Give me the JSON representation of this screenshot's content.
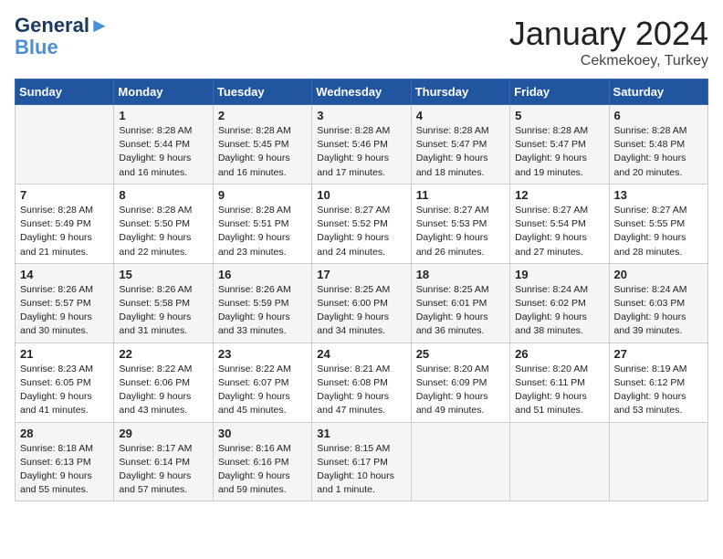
{
  "header": {
    "logo_line1": "General",
    "logo_line2": "Blue",
    "month": "January 2024",
    "location": "Cekmekoey, Turkey"
  },
  "weekdays": [
    "Sunday",
    "Monday",
    "Tuesday",
    "Wednesday",
    "Thursday",
    "Friday",
    "Saturday"
  ],
  "weeks": [
    [
      {
        "day": "",
        "info": ""
      },
      {
        "day": "1",
        "info": "Sunrise: 8:28 AM\nSunset: 5:44 PM\nDaylight: 9 hours\nand 16 minutes."
      },
      {
        "day": "2",
        "info": "Sunrise: 8:28 AM\nSunset: 5:45 PM\nDaylight: 9 hours\nand 16 minutes."
      },
      {
        "day": "3",
        "info": "Sunrise: 8:28 AM\nSunset: 5:46 PM\nDaylight: 9 hours\nand 17 minutes."
      },
      {
        "day": "4",
        "info": "Sunrise: 8:28 AM\nSunset: 5:47 PM\nDaylight: 9 hours\nand 18 minutes."
      },
      {
        "day": "5",
        "info": "Sunrise: 8:28 AM\nSunset: 5:47 PM\nDaylight: 9 hours\nand 19 minutes."
      },
      {
        "day": "6",
        "info": "Sunrise: 8:28 AM\nSunset: 5:48 PM\nDaylight: 9 hours\nand 20 minutes."
      }
    ],
    [
      {
        "day": "7",
        "info": "Sunrise: 8:28 AM\nSunset: 5:49 PM\nDaylight: 9 hours\nand 21 minutes."
      },
      {
        "day": "8",
        "info": "Sunrise: 8:28 AM\nSunset: 5:50 PM\nDaylight: 9 hours\nand 22 minutes."
      },
      {
        "day": "9",
        "info": "Sunrise: 8:28 AM\nSunset: 5:51 PM\nDaylight: 9 hours\nand 23 minutes."
      },
      {
        "day": "10",
        "info": "Sunrise: 8:27 AM\nSunset: 5:52 PM\nDaylight: 9 hours\nand 24 minutes."
      },
      {
        "day": "11",
        "info": "Sunrise: 8:27 AM\nSunset: 5:53 PM\nDaylight: 9 hours\nand 26 minutes."
      },
      {
        "day": "12",
        "info": "Sunrise: 8:27 AM\nSunset: 5:54 PM\nDaylight: 9 hours\nand 27 minutes."
      },
      {
        "day": "13",
        "info": "Sunrise: 8:27 AM\nSunset: 5:55 PM\nDaylight: 9 hours\nand 28 minutes."
      }
    ],
    [
      {
        "day": "14",
        "info": "Sunrise: 8:26 AM\nSunset: 5:57 PM\nDaylight: 9 hours\nand 30 minutes."
      },
      {
        "day": "15",
        "info": "Sunrise: 8:26 AM\nSunset: 5:58 PM\nDaylight: 9 hours\nand 31 minutes."
      },
      {
        "day": "16",
        "info": "Sunrise: 8:26 AM\nSunset: 5:59 PM\nDaylight: 9 hours\nand 33 minutes."
      },
      {
        "day": "17",
        "info": "Sunrise: 8:25 AM\nSunset: 6:00 PM\nDaylight: 9 hours\nand 34 minutes."
      },
      {
        "day": "18",
        "info": "Sunrise: 8:25 AM\nSunset: 6:01 PM\nDaylight: 9 hours\nand 36 minutes."
      },
      {
        "day": "19",
        "info": "Sunrise: 8:24 AM\nSunset: 6:02 PM\nDaylight: 9 hours\nand 38 minutes."
      },
      {
        "day": "20",
        "info": "Sunrise: 8:24 AM\nSunset: 6:03 PM\nDaylight: 9 hours\nand 39 minutes."
      }
    ],
    [
      {
        "day": "21",
        "info": "Sunrise: 8:23 AM\nSunset: 6:05 PM\nDaylight: 9 hours\nand 41 minutes."
      },
      {
        "day": "22",
        "info": "Sunrise: 8:22 AM\nSunset: 6:06 PM\nDaylight: 9 hours\nand 43 minutes."
      },
      {
        "day": "23",
        "info": "Sunrise: 8:22 AM\nSunset: 6:07 PM\nDaylight: 9 hours\nand 45 minutes."
      },
      {
        "day": "24",
        "info": "Sunrise: 8:21 AM\nSunset: 6:08 PM\nDaylight: 9 hours\nand 47 minutes."
      },
      {
        "day": "25",
        "info": "Sunrise: 8:20 AM\nSunset: 6:09 PM\nDaylight: 9 hours\nand 49 minutes."
      },
      {
        "day": "26",
        "info": "Sunrise: 8:20 AM\nSunset: 6:11 PM\nDaylight: 9 hours\nand 51 minutes."
      },
      {
        "day": "27",
        "info": "Sunrise: 8:19 AM\nSunset: 6:12 PM\nDaylight: 9 hours\nand 53 minutes."
      }
    ],
    [
      {
        "day": "28",
        "info": "Sunrise: 8:18 AM\nSunset: 6:13 PM\nDaylight: 9 hours\nand 55 minutes."
      },
      {
        "day": "29",
        "info": "Sunrise: 8:17 AM\nSunset: 6:14 PM\nDaylight: 9 hours\nand 57 minutes."
      },
      {
        "day": "30",
        "info": "Sunrise: 8:16 AM\nSunset: 6:16 PM\nDaylight: 9 hours\nand 59 minutes."
      },
      {
        "day": "31",
        "info": "Sunrise: 8:15 AM\nSunset: 6:17 PM\nDaylight: 10 hours\nand 1 minute."
      },
      {
        "day": "",
        "info": ""
      },
      {
        "day": "",
        "info": ""
      },
      {
        "day": "",
        "info": ""
      }
    ]
  ]
}
